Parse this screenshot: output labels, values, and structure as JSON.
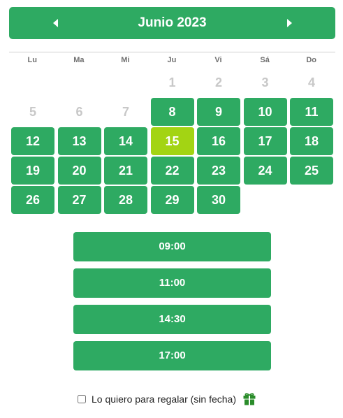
{
  "calendar": {
    "title": "Junio 2023",
    "prev_icon": "chevron-left-icon",
    "next_icon": "chevron-right-icon",
    "weekdays": [
      "Lu",
      "Ma",
      "Mi",
      "Ju",
      "Vi",
      "Sá",
      "Do"
    ],
    "selected_day": "15",
    "colors": {
      "available": "#2eaa62",
      "selected": "#a3d413",
      "disabled": "#c8c8c8"
    },
    "days": [
      {
        "label": "",
        "state": "empty"
      },
      {
        "label": "",
        "state": "empty"
      },
      {
        "label": "",
        "state": "empty"
      },
      {
        "label": "1",
        "state": "disabled"
      },
      {
        "label": "2",
        "state": "disabled"
      },
      {
        "label": "3",
        "state": "disabled"
      },
      {
        "label": "4",
        "state": "disabled"
      },
      {
        "label": "5",
        "state": "disabled"
      },
      {
        "label": "6",
        "state": "disabled"
      },
      {
        "label": "7",
        "state": "disabled"
      },
      {
        "label": "8",
        "state": "available"
      },
      {
        "label": "9",
        "state": "available"
      },
      {
        "label": "10",
        "state": "available"
      },
      {
        "label": "11",
        "state": "available"
      },
      {
        "label": "12",
        "state": "available"
      },
      {
        "label": "13",
        "state": "available"
      },
      {
        "label": "14",
        "state": "available"
      },
      {
        "label": "15",
        "state": "selected"
      },
      {
        "label": "16",
        "state": "available"
      },
      {
        "label": "17",
        "state": "available"
      },
      {
        "label": "18",
        "state": "available"
      },
      {
        "label": "19",
        "state": "available"
      },
      {
        "label": "20",
        "state": "available"
      },
      {
        "label": "21",
        "state": "available"
      },
      {
        "label": "22",
        "state": "available"
      },
      {
        "label": "23",
        "state": "available"
      },
      {
        "label": "24",
        "state": "available"
      },
      {
        "label": "25",
        "state": "available"
      },
      {
        "label": "26",
        "state": "available"
      },
      {
        "label": "27",
        "state": "available"
      },
      {
        "label": "28",
        "state": "available"
      },
      {
        "label": "29",
        "state": "available"
      },
      {
        "label": "30",
        "state": "available"
      }
    ]
  },
  "times": [
    "09:00",
    "11:00",
    "14:30",
    "17:00"
  ],
  "gift": {
    "label": "Lo quiero para regalar (sin fecha)",
    "checked": false,
    "icon": "gift-icon"
  }
}
